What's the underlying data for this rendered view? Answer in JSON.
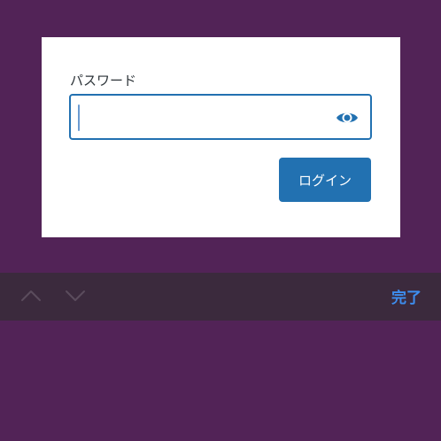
{
  "login_form": {
    "password_label": "パスワード",
    "password_value": "",
    "show_password_icon": "eye-icon",
    "login_button_label": "ログイン"
  },
  "keyboard_toolbar": {
    "previous_icon": "chevron-up-icon",
    "next_icon": "chevron-down-icon",
    "done_label": "完了"
  },
  "colors": {
    "background": "#522357",
    "accent": "#2271b1",
    "toolbar_background": "#3b2a3d",
    "done_text": "#3d8ef0"
  }
}
